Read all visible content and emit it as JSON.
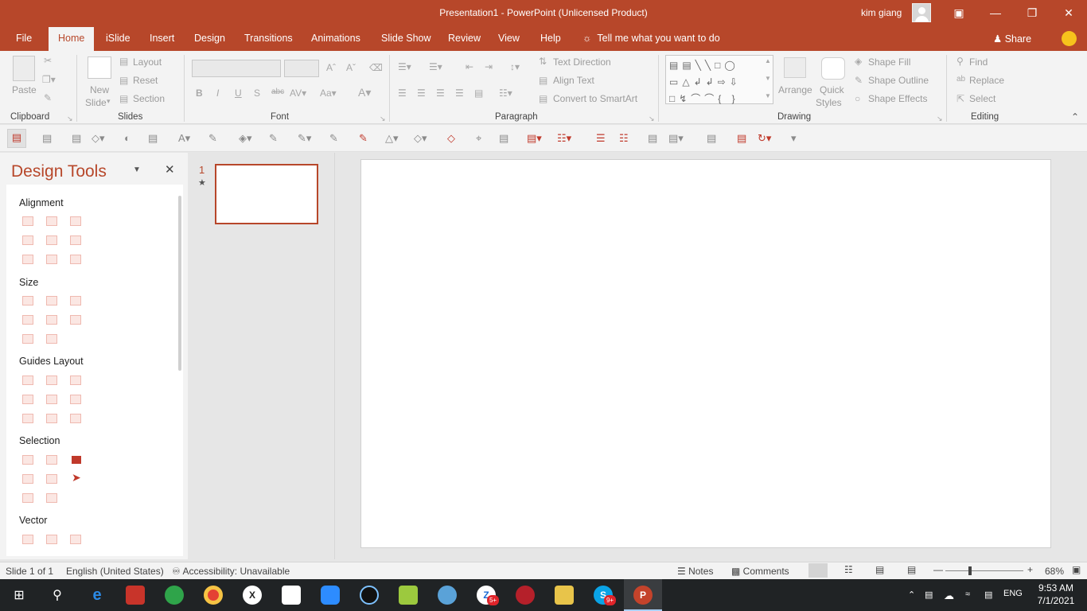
{
  "window": {
    "title": "Presentation1  -  PowerPoint (Unlicensed Product)",
    "user": "kim giang"
  },
  "tabs": [
    {
      "label": "File"
    },
    {
      "label": "Home"
    },
    {
      "label": "iSlide"
    },
    {
      "label": "Insert"
    },
    {
      "label": "Design"
    },
    {
      "label": "Transitions"
    },
    {
      "label": "Animations"
    },
    {
      "label": "Slide Show"
    },
    {
      "label": "Review"
    },
    {
      "label": "View"
    },
    {
      "label": "Help"
    }
  ],
  "tell_me": "Tell me what you want to do",
  "share": "Share",
  "ribbon": {
    "clipboard": {
      "label": "Clipboard",
      "paste": "Paste"
    },
    "slides": {
      "label": "Slides",
      "new_slide": "New",
      "new_slide2": "Slide",
      "layout": "Layout",
      "reset": "Reset",
      "section": "Section"
    },
    "font": {
      "label": "Font"
    },
    "paragraph": {
      "label": "Paragraph",
      "text_direction": "Text Direction",
      "align_text": "Align Text",
      "smartart": "Convert to SmartArt"
    },
    "drawing": {
      "label": "Drawing",
      "arrange": "Arrange",
      "quick_styles": "Quick",
      "quick_styles2": "Styles",
      "shape_fill": "Shape Fill",
      "shape_outline": "Shape Outline",
      "shape_effects": "Shape Effects"
    },
    "editing": {
      "label": "Editing",
      "find": "Find",
      "replace": "Replace",
      "select": "Select"
    }
  },
  "design_tools": {
    "title": "Design Tools",
    "sections": [
      "Alignment",
      "Size",
      "Guides Layout",
      "Selection",
      "Vector"
    ]
  },
  "thumbnails": {
    "number": "1",
    "star": "★"
  },
  "status": {
    "slide": "Slide 1 of 1",
    "language": "English (United States)",
    "accessibility": "Accessibility: Unavailable",
    "notes": "Notes",
    "comments": "Comments",
    "zoom": "68%"
  },
  "taskbar": {
    "language": "ENG",
    "time": "9:53 AM",
    "date": "7/1/2021",
    "badge_zalo": "5+",
    "badge_skype": "9+"
  },
  "colors": {
    "accent": "#b7472a",
    "taskbar": "#202325"
  }
}
